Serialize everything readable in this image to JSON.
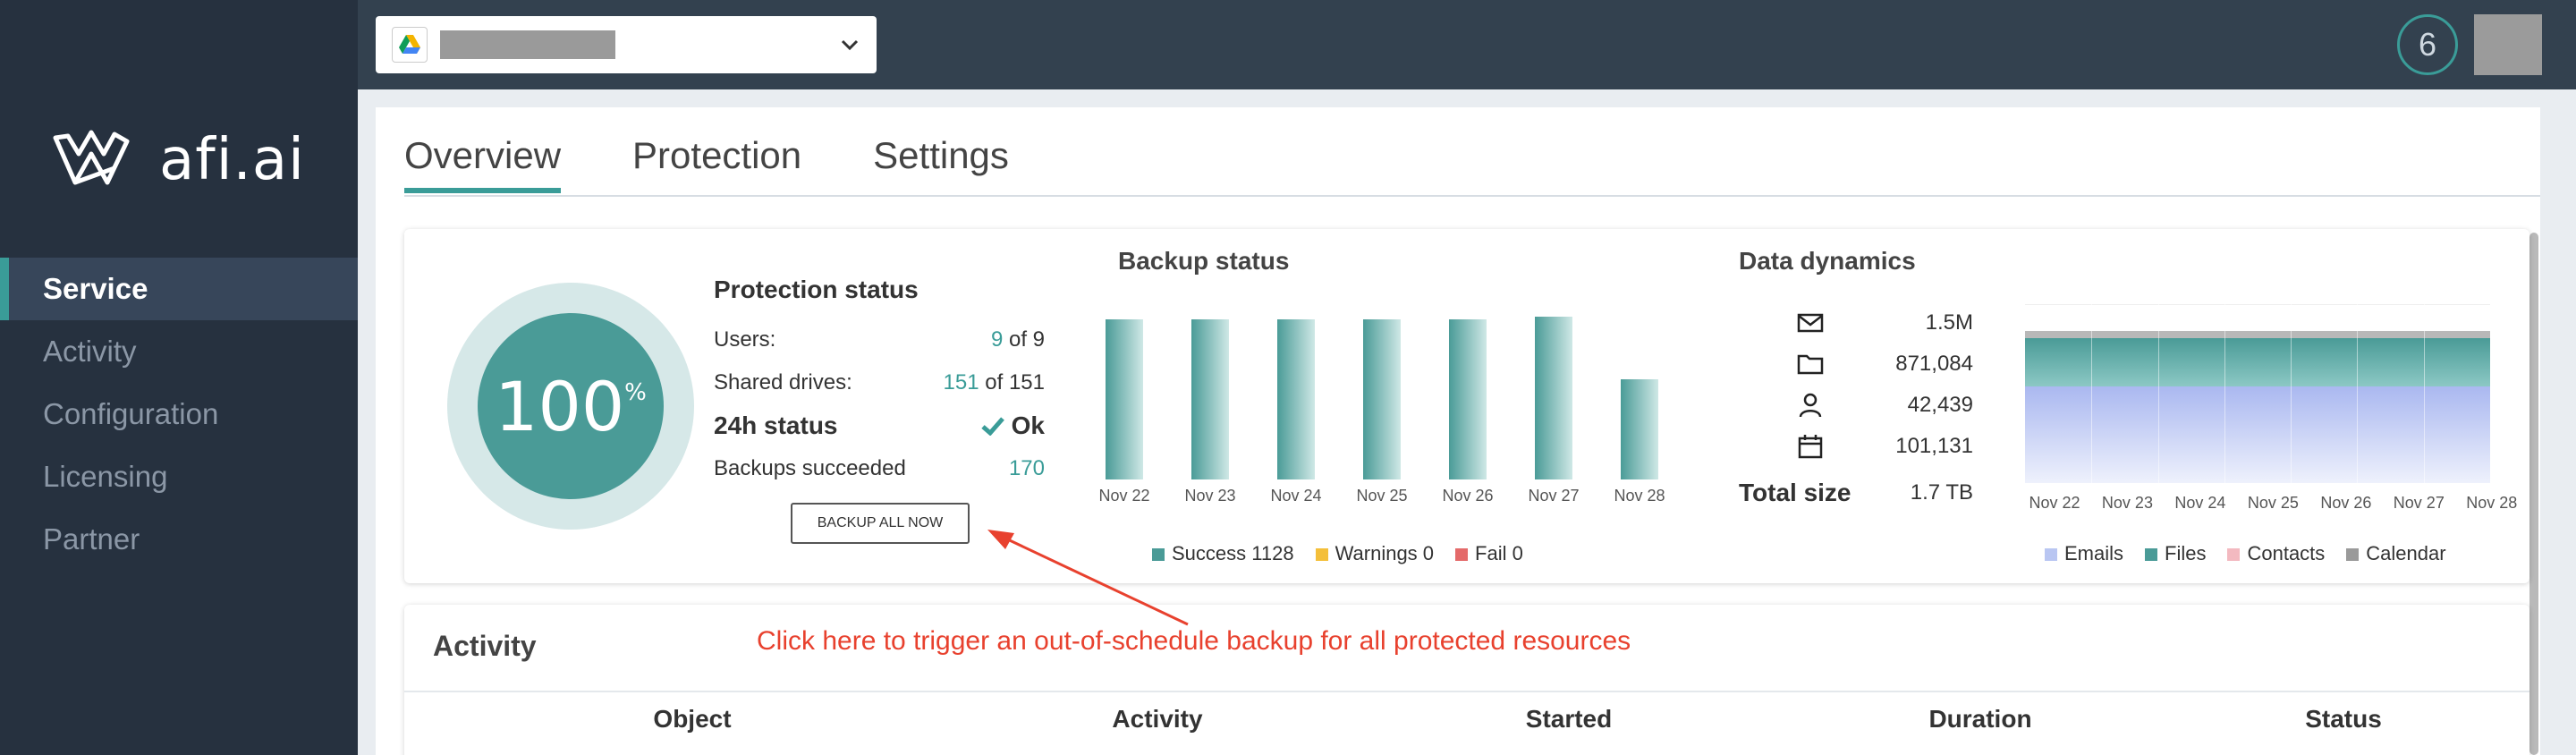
{
  "sidebar": {
    "logo_text": "afi.ai",
    "items": [
      {
        "label": "Service",
        "active": true
      },
      {
        "label": "Activity"
      },
      {
        "label": "Configuration"
      },
      {
        "label": "Licensing"
      },
      {
        "label": "Partner"
      }
    ]
  },
  "topbar": {
    "service_icon": "google-drive-icon",
    "notification_count": "6"
  },
  "tabs": [
    {
      "label": "Overview",
      "active": true
    },
    {
      "label": "Protection"
    },
    {
      "label": "Settings"
    }
  ],
  "overview": {
    "percent": "100",
    "percent_sign": "%",
    "protection": {
      "title": "Protection status",
      "users_label": "Users:",
      "users_value": "9",
      "users_total": "of 9",
      "drives_label": "Shared drives:",
      "drives_value": "151",
      "drives_total": "of 151",
      "status_label": "24h status",
      "status_value": "Ok",
      "backups_label": "Backups succeeded",
      "backups_value": "170",
      "backup_button": "BACKUP ALL NOW"
    }
  },
  "chart_data": [
    {
      "type": "bar",
      "title": "Backup status",
      "categories": [
        "Nov 22",
        "Nov 23",
        "Nov 24",
        "Nov 25",
        "Nov 26",
        "Nov 27",
        "Nov 28"
      ],
      "values": [
        170,
        170,
        170,
        170,
        170,
        172,
        106
      ],
      "ylim": [
        0,
        180
      ],
      "legend": [
        {
          "label": "Success 1128",
          "color": "#4a9b97"
        },
        {
          "label": "Warnings 0",
          "color": "#f4bf3a"
        },
        {
          "label": "Fail 0",
          "color": "#e46a6a"
        }
      ]
    },
    {
      "type": "area",
      "title": "Data dynamics",
      "categories": [
        "Nov 22",
        "Nov 23",
        "Nov 24",
        "Nov 25",
        "Nov 26",
        "Nov 27",
        "Nov 28"
      ],
      "stats": [
        {
          "icon": "mail-icon",
          "value": "1.5M"
        },
        {
          "icon": "folder-icon",
          "value": "871,084"
        },
        {
          "icon": "person-icon",
          "value": "42,439"
        },
        {
          "icon": "calendar-icon",
          "value": "101,131"
        }
      ],
      "total_label": "Total size",
      "total_value": "1.7 TB",
      "legend": [
        {
          "label": "Emails",
          "color": "#b9c6f2"
        },
        {
          "label": "Files",
          "color": "#4a9b97"
        },
        {
          "label": "Contacts",
          "color": "#f3b9c0"
        },
        {
          "label": "Calendar",
          "color": "#9a9a9a"
        }
      ]
    }
  ],
  "activity": {
    "title": "Activity",
    "columns": [
      "Object",
      "Activity",
      "Started",
      "Duration",
      "Status"
    ]
  },
  "annotation": {
    "text": "Click here to trigger an out-of-schedule backup for all protected resources",
    "color": "#e8412e"
  }
}
